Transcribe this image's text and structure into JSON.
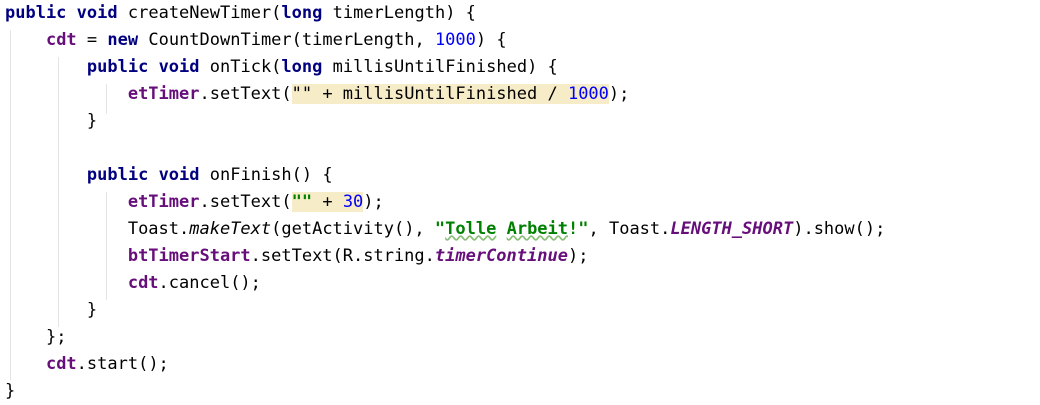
{
  "code": {
    "l1": {
      "kw_public": "public",
      "kw_void": "void",
      "name": "createNewTimer(",
      "kw_long": "long",
      "rest": "timerLength) {"
    },
    "l2": {
      "fld_cdt": "cdt",
      "eq": " = ",
      "kw_new": "new",
      "call": "CountDownTimer(timerLength, ",
      "num": "1000",
      "rest": ") {"
    },
    "l3": {
      "kw_public": "public",
      "kw_void": "void",
      "name": "onTick(",
      "kw_long": "long",
      "rest": "millisUntilFinished) {"
    },
    "l4": {
      "fld": "etTimer",
      "call": ".setText(",
      "expr": "\"\" + millisUntilFinished / ",
      "num": "1000",
      "rest": ");"
    },
    "l5": {
      "brace": "}"
    },
    "l6": {
      "kw_public": "public",
      "kw_void": "void",
      "rest": "onFinish() {"
    },
    "l7": {
      "fld": "etTimer",
      "call": ".setText(",
      "str": "\"\"",
      "plus": " + ",
      "num": "30",
      "rest": ");"
    },
    "l8": {
      "cls": "Toast.",
      "method": "makeText",
      "args": "(getActivity(), ",
      "str_open": "\"",
      "str_word1": "Tolle",
      "str_space": " ",
      "str_word2": "Arbeit",
      "str_close": "!\"",
      "mid": ", Toast.",
      "const": "LENGTH_SHORT",
      "rest": ").show();"
    },
    "l9": {
      "fld": "btTimerStart",
      "call": ".setText(R.string.",
      "field": "timerContinue",
      "rest": ");"
    },
    "l10": {
      "fld": "cdt",
      "rest": ".cancel();"
    },
    "l11": {
      "brace": "}"
    },
    "l12": {
      "rest": "};"
    },
    "l13": {
      "fld": "cdt",
      "rest": ".start();"
    },
    "l14": {
      "brace": "}"
    }
  },
  "colors": {
    "keyword": "#000080",
    "field": "#660e7a",
    "number": "#0000ff",
    "string": "#008000",
    "highlight": "#f7ecc8",
    "background": "#ffffff"
  }
}
